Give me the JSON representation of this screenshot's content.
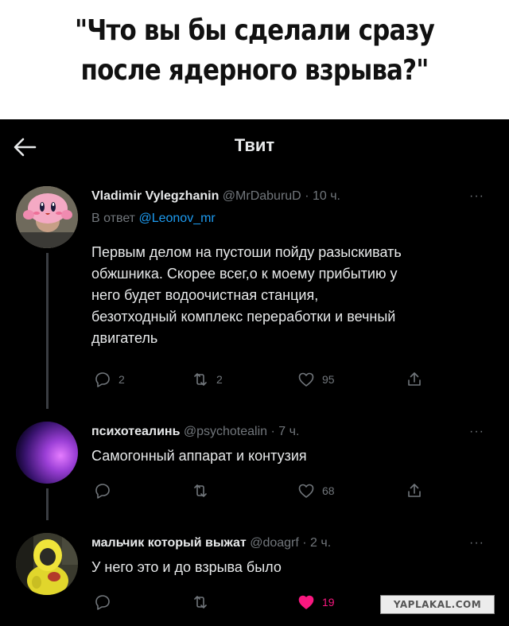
{
  "meme": {
    "title_line1": "\"Что вы бы сделали сразу",
    "title_line2": "после ядерного взрыва?\""
  },
  "header": {
    "title": "Твит",
    "back_icon": "arrow-left-icon"
  },
  "colors": {
    "background": "#000000",
    "text": "#e7e9ea",
    "muted": "#71767b",
    "link": "#1d9bf0",
    "like": "#f91880"
  },
  "tweets": [
    {
      "name": "Vladimir Vylegzhanin",
      "handle": "@MrDaburuD",
      "time": "· 10 ч.",
      "reply_label": "В ответ",
      "reply_to": "@Leonov_mr",
      "text_lines": [
        "Первым делом на пустоши пойду разыскивать",
        "обжшника. Скорее всег,о к моему прибытию у",
        "него будет водоочистная станция,",
        "безотходный комплекс переработки и вечный",
        "двигатель"
      ],
      "replies": "2",
      "retweets": "2",
      "likes": "95",
      "liked": false
    },
    {
      "name": "психотеалинь",
      "handle": "@psychotealin",
      "time": "· 7 ч.",
      "text_lines": [
        "Самогонный аппарат и контузия"
      ],
      "replies": "",
      "retweets": "",
      "likes": "68",
      "liked": false
    },
    {
      "name": "мальчик который выжат",
      "handle": "@doagrf",
      "time": "· 2 ч.",
      "text_lines": [
        "У него это и до взрыва было"
      ],
      "replies": "",
      "retweets": "",
      "likes": "19",
      "liked": true
    }
  ],
  "more_label": "···",
  "watermark": "YAPLAKAL.COM"
}
